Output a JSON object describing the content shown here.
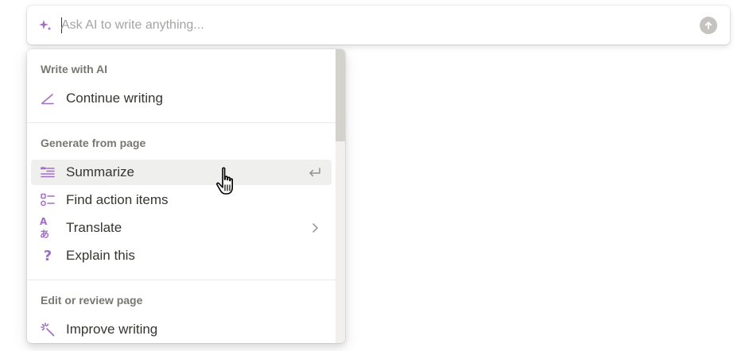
{
  "ask_bar": {
    "placeholder": "Ask AI to write anything...",
    "value": "",
    "sparkle_icon": "sparkle-icon",
    "submit_icon": "arrow-up-icon"
  },
  "menu": {
    "sections": [
      {
        "label": "Write with AI",
        "items": [
          {
            "label": "Continue writing",
            "icon": "pen-icon"
          }
        ]
      },
      {
        "label": "Generate from page",
        "items": [
          {
            "label": "Summarize",
            "icon": "summarize-icon",
            "highlighted": true,
            "trailing_icon": "enter-icon"
          },
          {
            "label": "Find action items",
            "icon": "checklist-icon"
          },
          {
            "label": "Translate",
            "icon": "translate-icon",
            "icon_text": "Aあ",
            "trailing_icon": "chevron-right-icon"
          },
          {
            "label": "Explain this",
            "icon": "question-icon",
            "icon_text": "?"
          }
        ]
      },
      {
        "label": "Edit or review page",
        "items": [
          {
            "label": "Improve writing",
            "icon": "magic-wand-icon"
          }
        ]
      }
    ]
  },
  "colors": {
    "accent": "#a06fc2",
    "text": "#37352f",
    "muted": "#787774",
    "placeholder": "#a5a4a0",
    "highlight_bg": "#efefee"
  }
}
